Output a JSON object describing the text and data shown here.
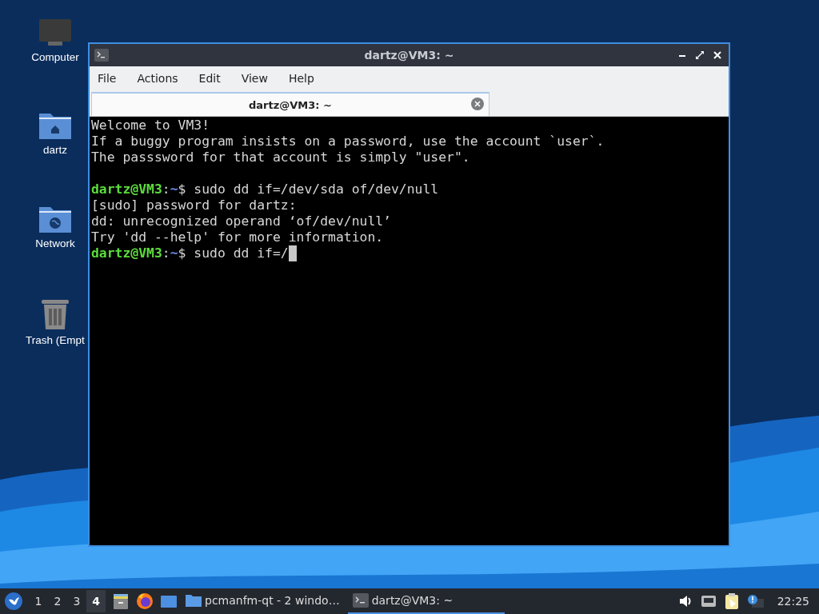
{
  "desktop_icons": [
    {
      "label": "Computer",
      "kind": "computer"
    },
    {
      "label": "dartz",
      "kind": "home"
    },
    {
      "label": "Network",
      "kind": "network"
    },
    {
      "label": "Trash (Empt",
      "kind": "trash"
    }
  ],
  "window": {
    "title": "dartz@VM3: ~",
    "menu": [
      "File",
      "Actions",
      "Edit",
      "View",
      "Help"
    ],
    "tabs": [
      {
        "label": "dartz@VM3: ~",
        "selected": true
      }
    ],
    "terminal": [
      {
        "kind": "text",
        "text": "Welcome to VM3!"
      },
      {
        "kind": "text",
        "text": "If a buggy program insists on a password, use the account `user`."
      },
      {
        "kind": "text",
        "text": "The passsword for that account is simply \"user\"."
      },
      {
        "kind": "blank"
      },
      {
        "kind": "prompt",
        "user": "dartz@VM3",
        "sep": ":",
        "path": "~",
        "command": "$ sudo dd if=/dev/sda of/dev/null",
        "cursor": false
      },
      {
        "kind": "text",
        "text": "[sudo] password for dartz:"
      },
      {
        "kind": "text",
        "text": "dd: unrecognized operand ‘of/dev/null’"
      },
      {
        "kind": "text",
        "text": "Try 'dd --help' for more information."
      },
      {
        "kind": "prompt",
        "user": "dartz@VM3",
        "sep": ":",
        "path": "~",
        "command": "$ sudo dd if=/",
        "cursor": true
      }
    ]
  },
  "taskbar": {
    "workspaces": [
      {
        "label": "1",
        "selected": false
      },
      {
        "label": "2",
        "selected": false
      },
      {
        "label": "3",
        "selected": false
      },
      {
        "label": "4",
        "selected": true
      }
    ],
    "tasks": [
      {
        "label": "pcmanfm-qt - 2 windo…",
        "kind": "folder",
        "selected": false
      },
      {
        "label": "dartz@VM3: ~",
        "kind": "terminal",
        "selected": true
      }
    ],
    "clock": "22:25"
  }
}
